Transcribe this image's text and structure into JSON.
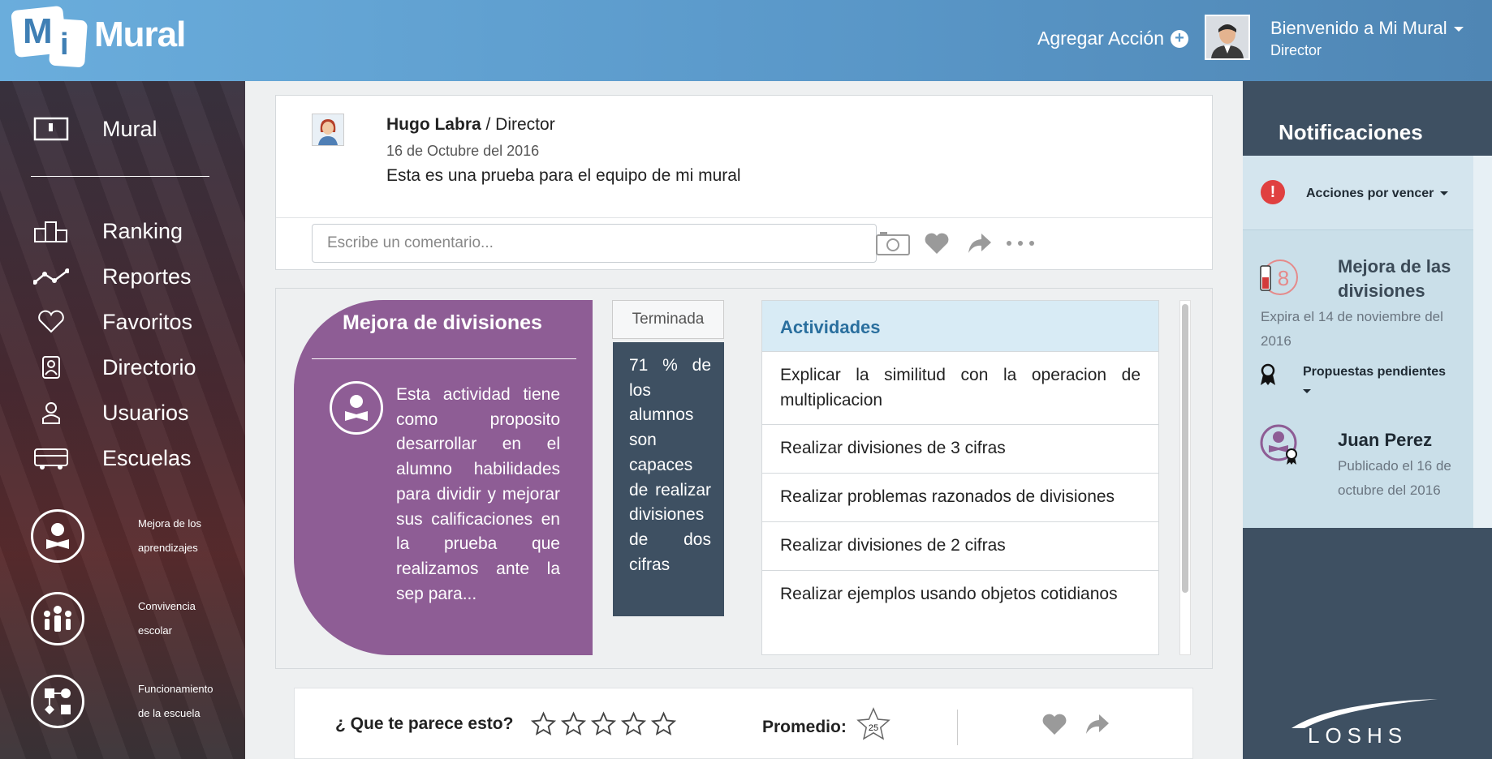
{
  "header": {
    "logo_m": "M",
    "logo_i": "i",
    "logo_word": "Mural",
    "add_action": "Agregar Acción",
    "welcome": "Bienvenido a Mi Mural",
    "role": "Director"
  },
  "sidebar": {
    "title": "Mural",
    "items": [
      {
        "label": "Ranking",
        "icon": "podium-icon"
      },
      {
        "label": "Reportes",
        "icon": "line-chart-icon"
      },
      {
        "label": "Favoritos",
        "icon": "heart-icon"
      },
      {
        "label": "Directorio",
        "icon": "contact-card-icon"
      },
      {
        "label": "Usuarios",
        "icon": "user-icon"
      },
      {
        "label": "Escuelas",
        "icon": "bus-icon"
      }
    ],
    "categories": [
      {
        "line1": "Mejora de los",
        "line2": "aprendizajes"
      },
      {
        "line1": "Convivencia",
        "line2": "escolar"
      },
      {
        "line1": "Funcionamiento",
        "line2": "de la escuela"
      }
    ]
  },
  "post": {
    "author": "Hugo Labra",
    "role": " / Director",
    "date": "16 de Octubre del 2016",
    "text": "Esta es una prueba para el equipo de mi mural",
    "comment_placeholder": "Escribe un comentario..."
  },
  "card": {
    "title": "Mejora de divisiones",
    "description": "Esta actividad tiene como proposito desarrollar en el alumno habilidades para dividir y mejorar sus calificaciones en la prueba que realizamos ante la sep para...",
    "status": "Terminada",
    "stat": "71 % de los alumnos son capaces de realizar divisiones de dos cifras",
    "activities_title": "Actividades",
    "activities": [
      "Explicar la similitud con la operacion de multiplicacion",
      "Realizar divisiones de 3 cifras",
      "Realizar problemas razonados de divisiones",
      "Realizar divisiones de 2 cifras",
      "Realizar ejemplos usando objetos cotidianos"
    ]
  },
  "rating": {
    "question": "¿ Que te parece esto?",
    "average_label": "Promedio:",
    "average_value": "25"
  },
  "notifications": {
    "title": "Notificaciones",
    "filter": "Acciones por vencer",
    "item1_title_1": "Mejora de las",
    "item1_title_2": "divisiones",
    "item1_expires": "Expira el 14 de noviembre del 2016",
    "item1_tag": "Propuestas pendientes",
    "item2_name": "Juan Perez",
    "item2_meta": "Publicado el 16 de octubre del 2016",
    "brand": "LOSHS"
  },
  "colors": {
    "header_blue": "#5a98c9",
    "sidebar_dark": "#4a2b33",
    "card_purple": "#8e5d95",
    "stat_slate": "#3e5062",
    "activities_head": "#d8ebf5",
    "notif_panel": "#cadfe9",
    "alert_red": "#e04040"
  }
}
